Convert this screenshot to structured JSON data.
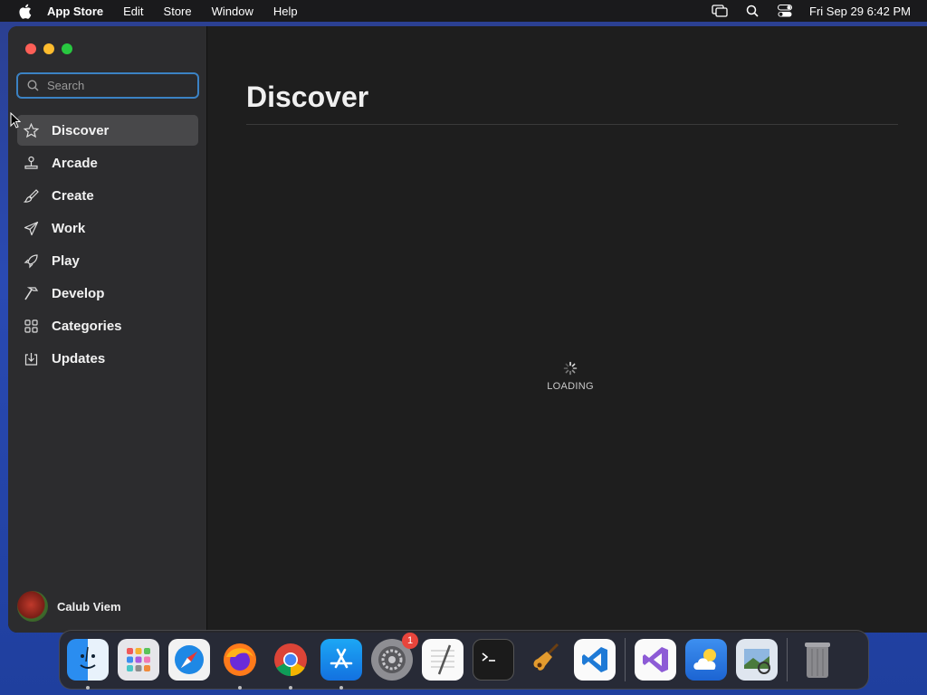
{
  "menubar": {
    "app_name": "App Store",
    "menus": [
      "Edit",
      "Store",
      "Window",
      "Help"
    ],
    "clock": "Fri Sep 29  6:42 PM"
  },
  "search": {
    "placeholder": "Search"
  },
  "sidebar": {
    "items": [
      {
        "label": "Discover",
        "icon": "star-icon",
        "active": true
      },
      {
        "label": "Arcade",
        "icon": "joystick-icon"
      },
      {
        "label": "Create",
        "icon": "brush-icon"
      },
      {
        "label": "Work",
        "icon": "paper-plane-icon"
      },
      {
        "label": "Play",
        "icon": "rocket-icon"
      },
      {
        "label": "Develop",
        "icon": "hammer-icon"
      },
      {
        "label": "Categories",
        "icon": "grid-icon"
      },
      {
        "label": "Updates",
        "icon": "download-icon"
      }
    ],
    "user_name": "Calub Viem"
  },
  "main": {
    "title": "Discover",
    "loading_text": "LOADING"
  },
  "dock": {
    "apps": [
      {
        "name": "Finder",
        "running": true
      },
      {
        "name": "Launchpad"
      },
      {
        "name": "Safari"
      },
      {
        "name": "Firefox",
        "running": true
      },
      {
        "name": "Chrome",
        "running": true
      },
      {
        "name": "App Store",
        "running": true
      },
      {
        "name": "System Settings",
        "badge": "1"
      },
      {
        "name": "TextEdit"
      },
      {
        "name": "Terminal"
      },
      {
        "name": "GarageBand"
      },
      {
        "name": "VS Code"
      },
      {
        "name": "Visual Studio"
      },
      {
        "name": "Weather"
      },
      {
        "name": "Preview"
      },
      {
        "name": "Trash"
      }
    ]
  },
  "colors": {
    "close": "#fe5f57",
    "minimize": "#febc2e",
    "maximize": "#28c840",
    "search_focus": "#3b82c4",
    "badge": "#e8453c"
  }
}
